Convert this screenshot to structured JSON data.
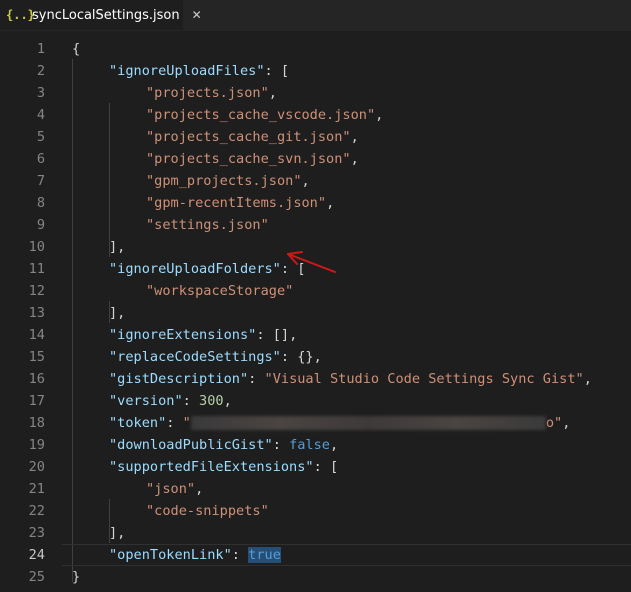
{
  "tab": {
    "icon_text": "{..}",
    "title": "syncLocalSettings.json",
    "close_glyph": "✕"
  },
  "editor": {
    "active_line": 24,
    "lines": [
      {
        "n": "1",
        "tokens": [
          {
            "t": "p",
            "v": "{"
          }
        ]
      },
      {
        "n": "2",
        "tokens": [
          {
            "t": "key",
            "v": "\"ignoreUploadFiles\""
          },
          {
            "t": "p",
            "v": ": ["
          }
        ]
      },
      {
        "n": "3",
        "tokens": [
          {
            "t": "str",
            "v": "\"projects.json\""
          },
          {
            "t": "p",
            "v": ","
          }
        ]
      },
      {
        "n": "4",
        "tokens": [
          {
            "t": "str",
            "v": "\"projects_cache_vscode.json\""
          },
          {
            "t": "p",
            "v": ","
          }
        ]
      },
      {
        "n": "5",
        "tokens": [
          {
            "t": "str",
            "v": "\"projects_cache_git.json\""
          },
          {
            "t": "p",
            "v": ","
          }
        ]
      },
      {
        "n": "6",
        "tokens": [
          {
            "t": "str",
            "v": "\"projects_cache_svn.json\""
          },
          {
            "t": "p",
            "v": ","
          }
        ]
      },
      {
        "n": "7",
        "tokens": [
          {
            "t": "str",
            "v": "\"gpm_projects.json\""
          },
          {
            "t": "p",
            "v": ","
          }
        ]
      },
      {
        "n": "8",
        "tokens": [
          {
            "t": "str",
            "v": "\"gpm-recentItems.json\""
          },
          {
            "t": "p",
            "v": ","
          }
        ]
      },
      {
        "n": "9",
        "tokens": [
          {
            "t": "str",
            "v": "\"settings.json\""
          }
        ]
      },
      {
        "n": "10",
        "tokens": [
          {
            "t": "p",
            "v": "],"
          }
        ]
      },
      {
        "n": "11",
        "tokens": [
          {
            "t": "key",
            "v": "\"ignoreUploadFolders\""
          },
          {
            "t": "p",
            "v": ": ["
          }
        ]
      },
      {
        "n": "12",
        "tokens": [
          {
            "t": "str",
            "v": "\"workspaceStorage\""
          }
        ]
      },
      {
        "n": "13",
        "tokens": [
          {
            "t": "p",
            "v": "],"
          }
        ]
      },
      {
        "n": "14",
        "tokens": [
          {
            "t": "key",
            "v": "\"ignoreExtensions\""
          },
          {
            "t": "p",
            "v": ": [],"
          }
        ]
      },
      {
        "n": "15",
        "tokens": [
          {
            "t": "key",
            "v": "\"replaceCodeSettings\""
          },
          {
            "t": "p",
            "v": ": {},"
          }
        ]
      },
      {
        "n": "16",
        "tokens": [
          {
            "t": "key",
            "v": "\"gistDescription\""
          },
          {
            "t": "p",
            "v": ": "
          },
          {
            "t": "str",
            "v": "\"Visual Studio Code Settings Sync Gist\""
          },
          {
            "t": "p",
            "v": ","
          }
        ]
      },
      {
        "n": "17",
        "tokens": [
          {
            "t": "key",
            "v": "\"version\""
          },
          {
            "t": "p",
            "v": ": "
          },
          {
            "t": "num",
            "v": "300"
          },
          {
            "t": "p",
            "v": ","
          }
        ]
      },
      {
        "n": "18",
        "tokens": [
          {
            "t": "key",
            "v": "\"token\""
          },
          {
            "t": "p",
            "v": ": "
          },
          {
            "t": "str",
            "v": "\""
          },
          {
            "t": "redacted",
            "v": ""
          },
          {
            "t": "str",
            "v": "o\""
          },
          {
            "t": "p",
            "v": ","
          }
        ]
      },
      {
        "n": "19",
        "tokens": [
          {
            "t": "key",
            "v": "\"downloadPublicGist\""
          },
          {
            "t": "p",
            "v": ": "
          },
          {
            "t": "kw",
            "v": "false"
          },
          {
            "t": "p",
            "v": ","
          }
        ]
      },
      {
        "n": "20",
        "tokens": [
          {
            "t": "key",
            "v": "\"supportedFileExtensions\""
          },
          {
            "t": "p",
            "v": ": ["
          }
        ]
      },
      {
        "n": "21",
        "tokens": [
          {
            "t": "str",
            "v": "\"json\""
          },
          {
            "t": "p",
            "v": ","
          }
        ]
      },
      {
        "n": "22",
        "tokens": [
          {
            "t": "str",
            "v": "\"code-snippets\""
          }
        ]
      },
      {
        "n": "23",
        "tokens": [
          {
            "t": "p",
            "v": "],"
          }
        ]
      },
      {
        "n": "24",
        "tokens": [
          {
            "t": "key",
            "v": "\"openTokenLink\""
          },
          {
            "t": "p",
            "v": ": "
          },
          {
            "t": "kw-sel",
            "v": "true"
          }
        ]
      },
      {
        "n": "25",
        "tokens": [
          {
            "t": "p",
            "v": "}"
          }
        ]
      }
    ]
  },
  "annotation": {
    "arrow_color": "#d01818"
  }
}
